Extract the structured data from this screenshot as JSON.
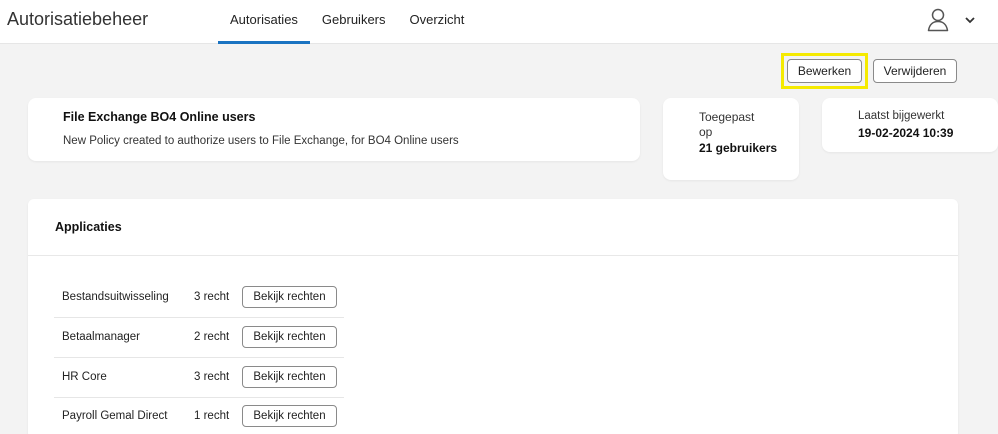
{
  "header": {
    "app_title": "Autorisatiebeheer",
    "tabs": [
      {
        "label": "Autorisaties",
        "active": true
      },
      {
        "label": "Gebruikers",
        "active": false
      },
      {
        "label": "Overzicht",
        "active": false
      }
    ],
    "accent_color": "#1a73c1"
  },
  "actions": {
    "edit_label": "Bewerken",
    "delete_label": "Verwijderen",
    "highlight_color": "#f5ea00"
  },
  "policy": {
    "title": "File Exchange BO4 Online users",
    "description": "New Policy created to authorize users to File Exchange, for BO4 Online users"
  },
  "applied": {
    "label": "Toegepast op",
    "value": "21 gebruikers"
  },
  "updated": {
    "label": "Laatst bijgewerkt",
    "value": "19-02-2024 10:39"
  },
  "applications": {
    "title": "Applicaties",
    "rows": [
      {
        "name": "Bestandsuitwisseling",
        "count": "3 recht",
        "button": "Bekijk rechten"
      },
      {
        "name": "Betaalmanager",
        "count": "2 recht",
        "button": "Bekijk rechten"
      },
      {
        "name": "HR Core",
        "count": "3 recht",
        "button": "Bekijk rechten"
      },
      {
        "name": "Payroll Gemal Direct",
        "count": "1 recht",
        "button": "Bekijk rechten"
      }
    ]
  }
}
